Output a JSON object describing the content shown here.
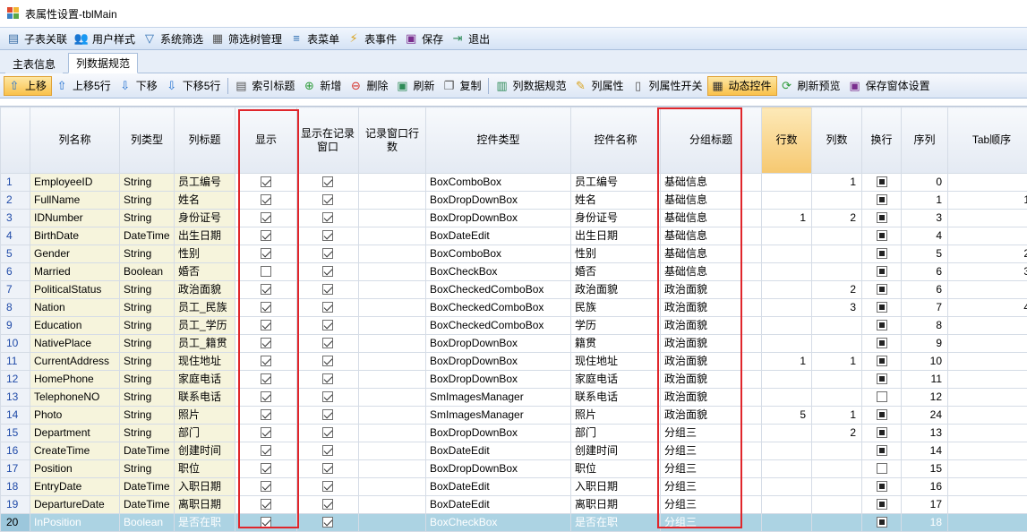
{
  "window": {
    "title": "表属性设置-tblMain"
  },
  "toolbar1": [
    {
      "label": "子表关联",
      "icon": "table-link-icon",
      "glyph": "▤",
      "color": "#3a6ea5"
    },
    {
      "label": "用户样式",
      "icon": "users-icon",
      "glyph": "👥",
      "color": "#3a6ea5"
    },
    {
      "label": "系统筛选",
      "icon": "filter-icon",
      "glyph": "▽",
      "color": "#2f6fb2"
    },
    {
      "label": "筛选树管理",
      "icon": "tree-icon",
      "glyph": "▦",
      "color": "#555"
    },
    {
      "label": "表菜单",
      "icon": "menu-icon",
      "glyph": "≡",
      "color": "#2f6fb2"
    },
    {
      "label": "表事件",
      "icon": "lightning-icon",
      "glyph": "⚡",
      "color": "#d9a21b"
    },
    {
      "label": "保存",
      "icon": "save-icon",
      "glyph": "▣",
      "color": "#7a2e8e"
    },
    {
      "label": "退出",
      "icon": "exit-icon",
      "glyph": "⇥",
      "color": "#2e8b57"
    }
  ],
  "tabs": [
    {
      "label": "主表信息",
      "selected": false
    },
    {
      "label": "列数据规范",
      "selected": true
    }
  ],
  "toolbar2": [
    {
      "label": "上移",
      "icon": "arrow-up-icon",
      "glyph": "⇧",
      "color": "#1f6fd0",
      "active": true
    },
    {
      "label": "上移5行",
      "icon": "arrow-up-icon",
      "glyph": "⇧",
      "color": "#1f6fd0"
    },
    {
      "label": "下移",
      "icon": "arrow-down-icon",
      "glyph": "⇩",
      "color": "#1f6fd0"
    },
    {
      "label": "下移5行",
      "icon": "arrow-down-icon",
      "glyph": "⇩",
      "color": "#1f6fd0"
    },
    {
      "sep": true
    },
    {
      "label": "索引标题",
      "icon": "index-icon",
      "glyph": "▤",
      "color": "#555"
    },
    {
      "label": "新增",
      "icon": "add-icon",
      "glyph": "⊕",
      "color": "#2e9b3a"
    },
    {
      "label": "删除",
      "icon": "delete-icon",
      "glyph": "⊖",
      "color": "#d6322a"
    },
    {
      "label": "刷新",
      "icon": "refresh-icon",
      "glyph": "▣",
      "color": "#2e8b57"
    },
    {
      "label": "复制",
      "icon": "copy-icon",
      "glyph": "❐",
      "color": "#555"
    },
    {
      "sep": true
    },
    {
      "label": "列数据规范",
      "icon": "columns-icon",
      "glyph": "▥",
      "color": "#2e8b57"
    },
    {
      "label": "列属性",
      "icon": "column-props-icon",
      "glyph": "✎",
      "color": "#d9a21b"
    },
    {
      "label": "列属性开关",
      "icon": "switch-icon",
      "glyph": "▯",
      "color": "#555"
    },
    {
      "label": "动态控件",
      "icon": "dynamic-control-icon",
      "glyph": "▦",
      "color": "#333",
      "active": true
    },
    {
      "label": "刷新预览",
      "icon": "refresh-preview-icon",
      "glyph": "⟳",
      "color": "#2e9b3a"
    },
    {
      "label": "保存窗体设置",
      "icon": "save-form-icon",
      "glyph": "▣",
      "color": "#7a2e8e"
    }
  ],
  "columns": [
    "",
    "列名称",
    "列类型",
    "列标题",
    "显示",
    "显示在记录窗口",
    "记录窗口行数",
    "控件类型",
    "控件名称",
    "分组标题",
    "行数",
    "列数",
    "换行",
    "序列",
    "Tab顺序"
  ],
  "rows": [
    {
      "n": "1",
      "name": "EmployeeID",
      "type": "String",
      "title": "员工编号",
      "show": true,
      "rec": true,
      "recRows": "",
      "ctl": "BoxComboBox",
      "ctlName": "员工编号",
      "group": "基础信息",
      "rowsN": "",
      "colsN": "1",
      "wrap": true,
      "seq": "0",
      "tab": ""
    },
    {
      "n": "2",
      "name": "FullName",
      "type": "String",
      "title": "姓名",
      "show": true,
      "rec": true,
      "recRows": "",
      "ctl": "BoxDropDownBox",
      "ctlName": "姓名",
      "group": "基础信息",
      "rowsN": "",
      "colsN": "",
      "wrap": true,
      "seq": "1",
      "tab": "1"
    },
    {
      "n": "3",
      "name": "IDNumber",
      "type": "String",
      "title": "身份证号",
      "show": true,
      "rec": true,
      "recRows": "",
      "ctl": "BoxDropDownBox",
      "ctlName": "身份证号",
      "group": "基础信息",
      "rowsN": "1",
      "colsN": "2",
      "wrap": true,
      "seq": "3",
      "tab": ""
    },
    {
      "n": "4",
      "name": "BirthDate",
      "type": "DateTime",
      "title": "出生日期",
      "show": true,
      "rec": true,
      "recRows": "",
      "ctl": "BoxDateEdit",
      "ctlName": "出生日期",
      "group": "基础信息",
      "rowsN": "",
      "colsN": "",
      "wrap": true,
      "seq": "4",
      "tab": ""
    },
    {
      "n": "5",
      "name": "Gender",
      "type": "String",
      "title": "性别",
      "show": true,
      "rec": true,
      "recRows": "",
      "ctl": "BoxComboBox",
      "ctlName": "性别",
      "group": "基础信息",
      "rowsN": "",
      "colsN": "",
      "wrap": true,
      "seq": "5",
      "tab": "2"
    },
    {
      "n": "6",
      "name": "Married",
      "type": "Boolean",
      "title": "婚否",
      "show": false,
      "rec": true,
      "recRows": "",
      "ctl": "BoxCheckBox",
      "ctlName": "婚否",
      "group": "基础信息",
      "rowsN": "",
      "colsN": "",
      "wrap": true,
      "seq": "6",
      "tab": "3"
    },
    {
      "n": "7",
      "name": "PoliticalStatus",
      "type": "String",
      "title": "政治面貌",
      "show": true,
      "rec": true,
      "recRows": "",
      "ctl": "BoxCheckedComboBox",
      "ctlName": "政治面貌",
      "group": "政治面貌",
      "rowsN": "",
      "colsN": "2",
      "wrap": true,
      "seq": "6",
      "tab": ""
    },
    {
      "n": "8",
      "name": "Nation",
      "type": "String",
      "title": "员工_民族",
      "show": true,
      "rec": true,
      "recRows": "",
      "ctl": "BoxCheckedComboBox",
      "ctlName": "民族",
      "group": "政治面貌",
      "rowsN": "",
      "colsN": "3",
      "wrap": true,
      "seq": "7",
      "tab": "4"
    },
    {
      "n": "9",
      "name": "Education",
      "type": "String",
      "title": "员工_学历",
      "show": true,
      "rec": true,
      "recRows": "",
      "ctl": "BoxCheckedComboBox",
      "ctlName": "学历",
      "group": "政治面貌",
      "rowsN": "",
      "colsN": "",
      "wrap": true,
      "seq": "8",
      "tab": ""
    },
    {
      "n": "10",
      "name": "NativePlace",
      "type": "String",
      "title": "员工_籍贯",
      "show": true,
      "rec": true,
      "recRows": "",
      "ctl": "BoxDropDownBox",
      "ctlName": "籍贯",
      "group": "政治面貌",
      "rowsN": "",
      "colsN": "",
      "wrap": true,
      "seq": "9",
      "tab": ""
    },
    {
      "n": "11",
      "name": "CurrentAddress",
      "type": "String",
      "title": "现住地址",
      "show": true,
      "rec": true,
      "recRows": "",
      "ctl": "BoxDropDownBox",
      "ctlName": "现住地址",
      "group": "政治面貌",
      "rowsN": "1",
      "colsN": "1",
      "wrap": true,
      "seq": "10",
      "tab": ""
    },
    {
      "n": "12",
      "name": "HomePhone",
      "type": "String",
      "title": "家庭电话",
      "show": true,
      "rec": true,
      "recRows": "",
      "ctl": "BoxDropDownBox",
      "ctlName": "家庭电话",
      "group": "政治面貌",
      "rowsN": "",
      "colsN": "",
      "wrap": true,
      "seq": "11",
      "tab": ""
    },
    {
      "n": "13",
      "name": "TelephoneNO",
      "type": "String",
      "title": "联系电话",
      "show": true,
      "rec": true,
      "recRows": "",
      "ctl": "SmImagesManager",
      "ctlName": "联系电话",
      "group": "政治面貌",
      "rowsN": "",
      "colsN": "",
      "wrap": false,
      "seq": "12",
      "tab": ""
    },
    {
      "n": "14",
      "name": "Photo",
      "type": "String",
      "title": "照片",
      "show": true,
      "rec": true,
      "recRows": "",
      "ctl": "SmImagesManager",
      "ctlName": "照片",
      "group": "政治面貌",
      "rowsN": "5",
      "colsN": "1",
      "wrap": true,
      "seq": "24",
      "tab": ""
    },
    {
      "n": "15",
      "name": "Department",
      "type": "String",
      "title": "部门",
      "show": true,
      "rec": true,
      "recRows": "",
      "ctl": "BoxDropDownBox",
      "ctlName": "部门",
      "group": "分组三",
      "rowsN": "",
      "colsN": "2",
      "wrap": true,
      "seq": "13",
      "tab": ""
    },
    {
      "n": "16",
      "name": "CreateTime",
      "type": "DateTime",
      "title": "创建时间",
      "show": true,
      "rec": true,
      "recRows": "",
      "ctl": "BoxDateEdit",
      "ctlName": "创建时间",
      "group": "分组三",
      "rowsN": "",
      "colsN": "",
      "wrap": true,
      "seq": "14",
      "tab": ""
    },
    {
      "n": "17",
      "name": "Position",
      "type": "String",
      "title": "职位",
      "show": true,
      "rec": true,
      "recRows": "",
      "ctl": "BoxDropDownBox",
      "ctlName": "职位",
      "group": "分组三",
      "rowsN": "",
      "colsN": "",
      "wrap": false,
      "seq": "15",
      "tab": ""
    },
    {
      "n": "18",
      "name": "EntryDate",
      "type": "DateTime",
      "title": "入职日期",
      "show": true,
      "rec": true,
      "recRows": "",
      "ctl": "BoxDateEdit",
      "ctlName": "入职日期",
      "group": "分组三",
      "rowsN": "",
      "colsN": "",
      "wrap": true,
      "seq": "16",
      "tab": ""
    },
    {
      "n": "19",
      "name": "DepartureDate",
      "type": "DateTime",
      "title": "离职日期",
      "show": true,
      "rec": true,
      "recRows": "",
      "ctl": "BoxDateEdit",
      "ctlName": "离职日期",
      "group": "分组三",
      "rowsN": "",
      "colsN": "",
      "wrap": true,
      "seq": "17",
      "tab": ""
    },
    {
      "n": "20",
      "name": "InPosition",
      "type": "Boolean",
      "title": "是否在职",
      "show": true,
      "rec": true,
      "recRows": "",
      "ctl": "BoxCheckBox",
      "ctlName": "是否在职",
      "group": "分组三",
      "rowsN": "",
      "colsN": "",
      "wrap": true,
      "seq": "18",
      "tab": "",
      "selected": true
    }
  ],
  "colors": {
    "highlight_box": "#e0262b",
    "selected_row": "#acd3e3",
    "header_highlight": "#f6c870",
    "key_cell": "#f6f4dc"
  }
}
